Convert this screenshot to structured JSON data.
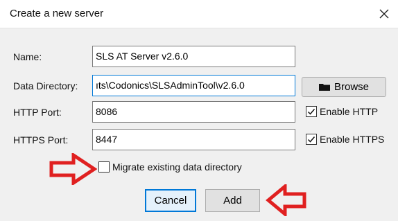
{
  "window": {
    "title": "Create a new server"
  },
  "fields": {
    "name": {
      "label": "Name:",
      "value": "SLS AT Server v2.6.0"
    },
    "data_directory": {
      "label": "Data Directory:",
      "value": "ıts\\Codonics\\SLSAdminTool\\v2.6.0"
    },
    "http_port": {
      "label": "HTTP Port:",
      "value": "8086"
    },
    "https_port": {
      "label": "HTTPS Port:",
      "value": "8447"
    }
  },
  "buttons": {
    "browse": "Browse",
    "cancel": "Cancel",
    "add": "Add"
  },
  "checkboxes": {
    "enable_http": {
      "label": "Enable HTTP",
      "checked": true
    },
    "enable_https": {
      "label": "Enable HTTPS",
      "checked": true
    },
    "migrate": {
      "label": "Migrate existing data directory",
      "checked": false
    }
  },
  "icons": {
    "close": "close-icon",
    "browse": "folder-icon",
    "annotation": "red-arrow-icon"
  },
  "colors": {
    "annotation_arrow": "#e02020",
    "focus_border": "#0078d7"
  }
}
